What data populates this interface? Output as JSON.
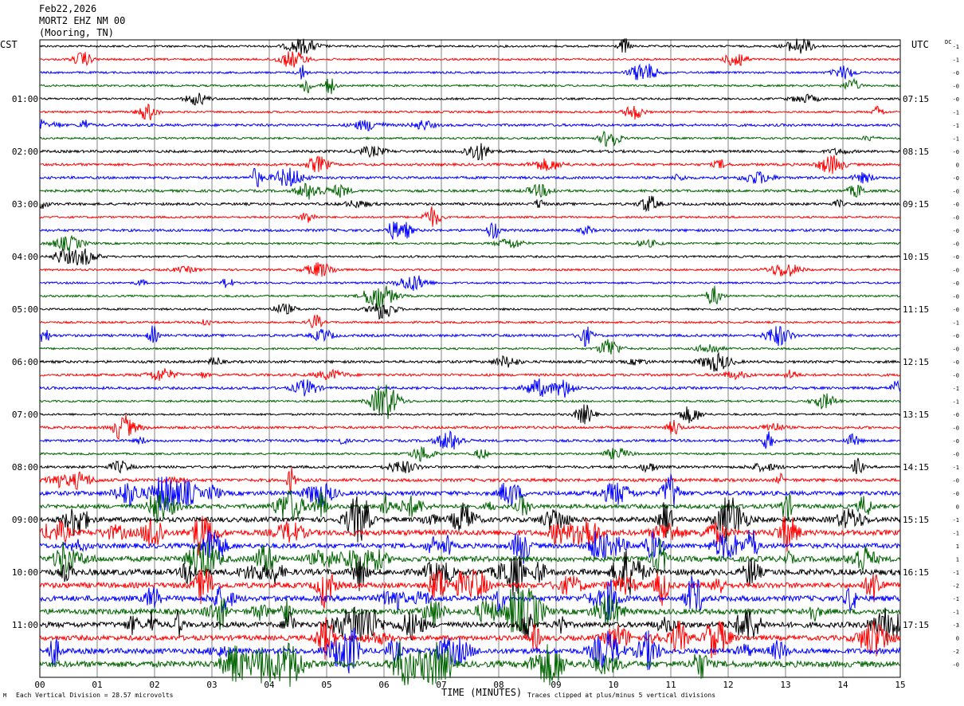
{
  "header": {
    "date": "Feb22,2026",
    "station": "MORT2 EHZ NM 00",
    "location": "(Mooring, TN)"
  },
  "left_tz": "CST",
  "right_tz": "UTC",
  "dc_label": "DC",
  "footer": {
    "scale": "Each Vertical Division = 28.57 microvolts",
    "clip": "Traces clipped at plus/minus 5 vertical divisions",
    "corner": "M"
  },
  "colors": {
    "black": "#000000",
    "red": "#ff0000",
    "blue": "#0000ff",
    "green": "#006400",
    "grid": "#808080"
  },
  "chart_data": {
    "type": "line",
    "title": "",
    "xlabel": "TIME (MINUTES)",
    "x_ticks": [
      "00",
      "01",
      "02",
      "03",
      "04",
      "05",
      "06",
      "07",
      "08",
      "09",
      "10",
      "11",
      "12",
      "13",
      "14",
      "15"
    ],
    "left_ticks": [
      "01:00",
      "02:00",
      "03:00",
      "04:00",
      "05:00",
      "06:00",
      "07:00",
      "08:00",
      "09:00",
      "10:00",
      "11:00"
    ],
    "right_ticks": [
      "07:15",
      "08:15",
      "09:15",
      "10:15",
      "11:15",
      "12:15",
      "13:15",
      "14:15",
      "15:15",
      "16:15",
      "17:15"
    ],
    "trace_count": 48,
    "trace_minutes": 15,
    "traces_per_hour": 4,
    "trace_colors": [
      "black",
      "red",
      "blue",
      "green"
    ],
    "dc_offsets": [
      "-1",
      "-1",
      "-0",
      "-0",
      "-0",
      "-1",
      "-1",
      "-1",
      "-0",
      "0",
      "-0",
      "-0",
      "-0",
      "-0",
      "-0",
      "-0",
      "-0",
      "-0",
      "-0",
      "-0",
      "-0",
      "-1",
      "-0",
      "-0",
      "-0",
      "-0",
      "-1",
      "-1",
      "-0",
      "-0",
      "-0",
      "-0",
      "-1",
      "-0",
      "-0",
      "0",
      "-1",
      "-1",
      "1",
      "1",
      "-1",
      "-2",
      "-1",
      "-1",
      "-3",
      "0",
      "-2",
      "-0"
    ],
    "activity_level": [
      1,
      1,
      1,
      1,
      1,
      1,
      2,
      1,
      2,
      2,
      2,
      2,
      2,
      1,
      2,
      1,
      1,
      1,
      1,
      1,
      1,
      1,
      2,
      1,
      2,
      2,
      2,
      1,
      1,
      2,
      2,
      1,
      2,
      3,
      5,
      5,
      6,
      7,
      6,
      7,
      8,
      7,
      7,
      7,
      7,
      6,
      7,
      8
    ]
  }
}
